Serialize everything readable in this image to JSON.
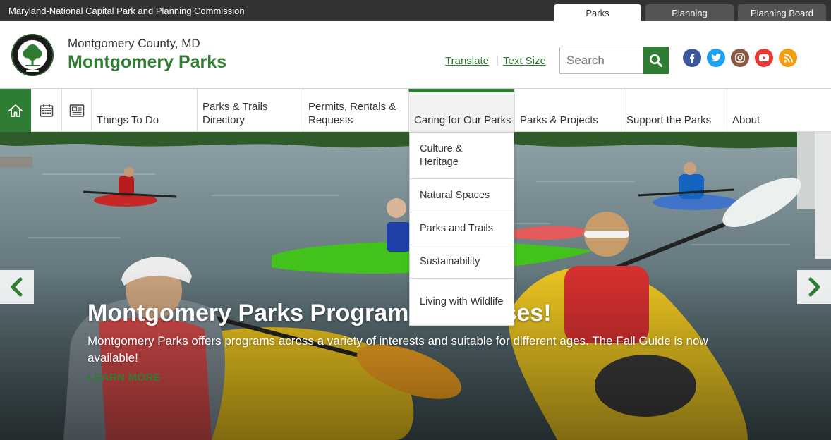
{
  "utility_bar": {
    "org_name": "Maryland-National Capital Park and Planning Commission",
    "tabs": [
      {
        "label": "Parks",
        "active": true
      },
      {
        "label": "Planning",
        "active": false
      },
      {
        "label": "Planning Board",
        "active": false
      }
    ]
  },
  "header": {
    "logo": {
      "icon": "montgomery-parks-seal",
      "ring_text": "MONTGOMERY PARKS",
      "bottom_text": "M-NCPPC"
    },
    "county": "Montgomery County, MD",
    "brand": "Montgomery Parks",
    "links": {
      "translate": "Translate",
      "text_size": "Text Size"
    },
    "search": {
      "placeholder": "Search",
      "value": "",
      "icon": "search-icon"
    },
    "social": [
      {
        "name": "facebook",
        "icon": "facebook-icon",
        "color": "#3b5998"
      },
      {
        "name": "twitter",
        "icon": "twitter-icon",
        "color": "#1da1f2"
      },
      {
        "name": "instagram",
        "icon": "instagram-icon",
        "color": "#8a5a44"
      },
      {
        "name": "youtube",
        "icon": "youtube-icon",
        "color": "#e53935"
      },
      {
        "name": "rss",
        "icon": "rss-icon",
        "color": "#f39c12"
      }
    ]
  },
  "nav": {
    "icons": [
      "home-icon",
      "calendar-icon",
      "news-icon"
    ],
    "items": [
      {
        "label": "Things To Do"
      },
      {
        "label": "Parks & Trails Directory"
      },
      {
        "label": "Permits, Rentals & Requests"
      },
      {
        "label": "Caring for Our Parks",
        "active": true
      },
      {
        "label": "Parks & Projects"
      },
      {
        "label": "Support the Parks"
      },
      {
        "label": "About"
      }
    ],
    "dropdown": [
      {
        "label": "Culture & Heritage"
      },
      {
        "label": "Natural Spaces"
      },
      {
        "label": "Parks and Trails"
      },
      {
        "label": "Sustainability"
      },
      {
        "label": "Living with Wildlife"
      }
    ]
  },
  "hero": {
    "title": "Montgomery Parks Programs & Classes!",
    "description": "Montgomery Parks offers programs across a variety of interests and suitable for different ages. The Fall Guide is now available!",
    "cta": "LEARN MORE",
    "prev_icon": "chevron-left-icon",
    "next_icon": "chevron-right-icon"
  },
  "colors": {
    "brand_green": "#2e7d32",
    "utility_bar": "#333333"
  }
}
